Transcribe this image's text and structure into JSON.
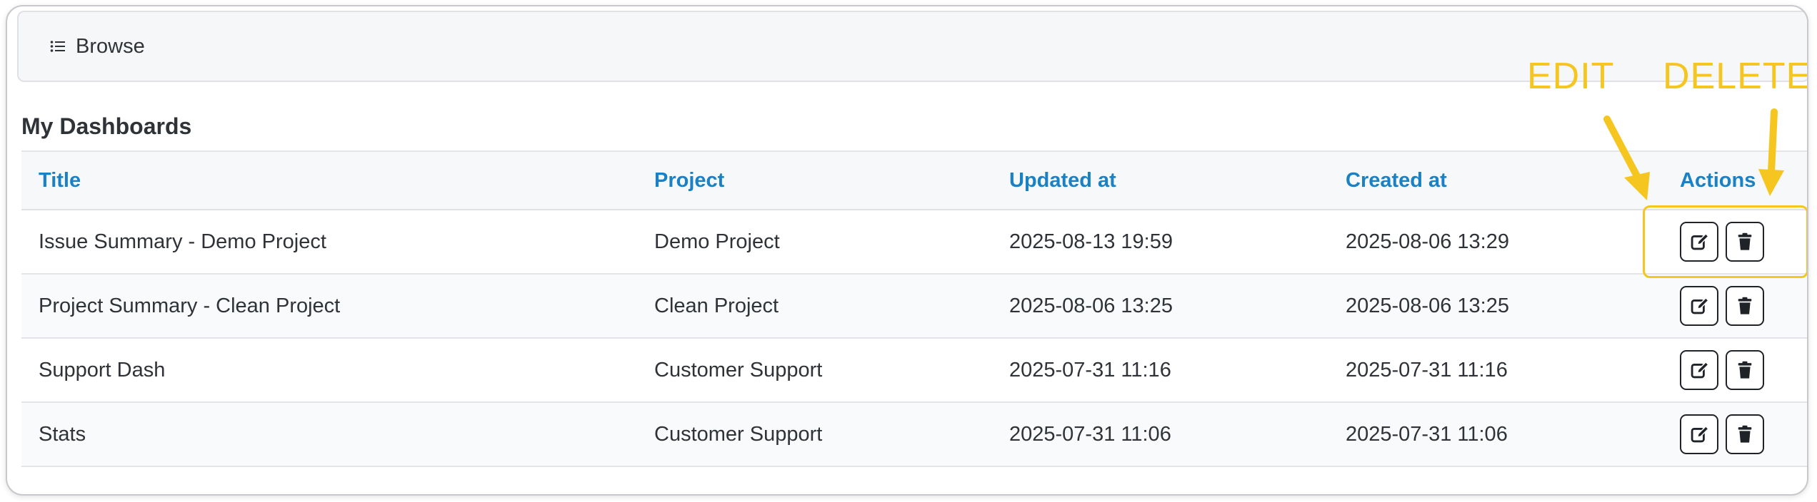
{
  "nav": {
    "browse_label": "Browse",
    "browse_icon": "list-icon"
  },
  "section": {
    "title": "My Dashboards"
  },
  "table": {
    "columns": {
      "title": "Title",
      "project": "Project",
      "updated": "Updated at",
      "created": "Created at",
      "actions": "Actions"
    },
    "rows": [
      {
        "title": "Issue Summary - Demo Project",
        "project": "Demo Project",
        "updated": "2025-08-13 19:59",
        "created": "2025-08-06 13:29"
      },
      {
        "title": "Project Summary - Clean Project",
        "project": "Clean Project",
        "updated": "2025-08-06 13:25",
        "created": "2025-08-06 13:25"
      },
      {
        "title": "Support Dash",
        "project": "Customer Support",
        "updated": "2025-07-31 11:16",
        "created": "2025-07-31 11:16"
      },
      {
        "title": "Stats",
        "project": "Customer Support",
        "updated": "2025-07-31 11:06",
        "created": "2025-07-31 11:06"
      }
    ],
    "row_actions": [
      "edit-icon",
      "trash-icon"
    ]
  },
  "annotations": {
    "edit_label": "EDIT",
    "delete_label": "DELETE",
    "color": "#f5c520"
  },
  "colors": {
    "header_text": "#1a82c4",
    "body_text": "#2f3338"
  }
}
